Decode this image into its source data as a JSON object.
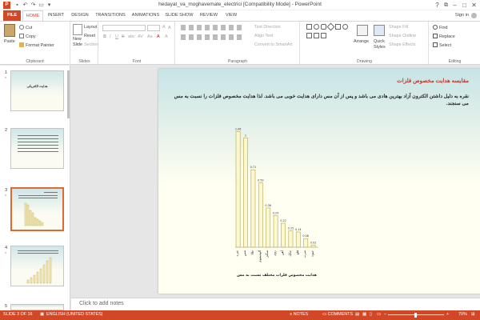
{
  "title_bar": {
    "app_icon": "P",
    "doc_title": "hedayat_va_moghavemate_electrici [Compatibility Mode] - PowerPoint",
    "qat_icons": [
      "save-icon",
      "undo-icon",
      "redo-icon",
      "slideshow-icon",
      "customize-icon"
    ],
    "help": "?",
    "restore": "⧉",
    "minimize": "–",
    "maximize": "□",
    "close": "✕"
  },
  "tabs": [
    "FILE",
    "HOME",
    "INSERT",
    "DESIGN",
    "TRANSITIONS",
    "ANIMATIONS",
    "SLIDE SHOW",
    "REVIEW",
    "VIEW"
  ],
  "account": {
    "sign_in": "Sign in"
  },
  "ribbon": {
    "clipboard": {
      "label": "Clipboard",
      "paste": "Paste",
      "cut": "Cut",
      "copy": "Copy",
      "format_painter": "Format Painter"
    },
    "slides": {
      "label": "Slides",
      "new_slide": "New",
      "new_slide_2": "Slide",
      "layout": "Layout",
      "reset": "Reset",
      "section": "Section"
    },
    "font": {
      "label": "Font",
      "font_name": "",
      "font_size": "",
      "bold": "B",
      "italic": "I",
      "underline": "U",
      "strike": "S",
      "shadow": "abc",
      "spacing": "AV",
      "case": "Aa",
      "color": "A",
      "grow": "A",
      "shrink": "A",
      "clear": "A"
    },
    "paragraph": {
      "label": "Paragraph",
      "text_direction": "Text Direction",
      "align_text": "Align Text",
      "convert_smartart": "Convert to SmartArt"
    },
    "drawing": {
      "label": "Drawing",
      "arrange": "Arrange",
      "quick_styles": "Quick",
      "quick_styles_2": "Styles",
      "shape_fill": "Shape Fill",
      "shape_outline": "Shape Outline",
      "shape_effects": "Shape Effects"
    },
    "editing": {
      "label": "Editing",
      "find": "Find",
      "replace": "Replace",
      "select": "Select"
    }
  },
  "thumbnails": [
    {
      "num": "1",
      "star": "*",
      "title": "هدایت الکتریکی"
    },
    {
      "num": "2",
      "star": ""
    },
    {
      "num": "3",
      "star": "*"
    },
    {
      "num": "4",
      "star": "*"
    },
    {
      "num": "5",
      "star": ""
    }
  ],
  "slide": {
    "title": "مقایسه هدایت مخصوص فلزات",
    "body": "نقره به دلیل داشتن الکترون آزاد بهترین هادی می باشد و پس از آن مس دارای هدایت خوبی می باشد. لذا هدایت مخصوص فلزات را نسبت به مس می سنجند."
  },
  "chart_data": {
    "type": "bar",
    "categories": [
      "نقره",
      "مس",
      "طلا",
      "آلومینیوم",
      "منگنز",
      "روی",
      "آهن",
      "نیکل",
      "قلع",
      "سرب",
      "جیوه"
    ],
    "values": [
      1.06,
      1.0,
      0.71,
      0.59,
      0.36,
      0.29,
      0.22,
      0.15,
      0.14,
      0.08,
      0.02
    ],
    "value_labels": [
      "1.06",
      "1",
      "0.71",
      "0.59",
      "0.36",
      "0.29",
      "0.22",
      "0.15",
      "0.14",
      "0.08",
      "0.02"
    ],
    "xlabel": "هدایت مخصوص فلزات مختلف نسبت به مس",
    "ylim": [
      0,
      1.1
    ],
    "colors": {
      "bar_fill": "#fbf7cf",
      "bar_stroke": "#b9a44a"
    }
  },
  "notes": {
    "placeholder": "Click to add notes"
  },
  "status": {
    "slide_of": "SLIDE 3 OF 16",
    "language": "ENGLISH (UNITED STATES)",
    "notes": "NOTES",
    "comments": "COMMENTS",
    "zoom": "70%",
    "zoom_out": "–",
    "zoom_in": "+"
  },
  "colors": {
    "accent": "#d24726",
    "title_red": "#c0392b"
  }
}
